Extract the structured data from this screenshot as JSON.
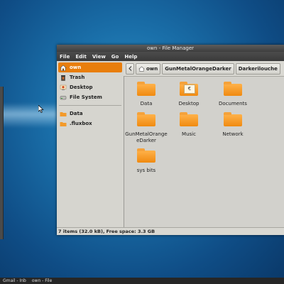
{
  "window": {
    "title": "own - File Manager"
  },
  "menu": [
    "File",
    "Edit",
    "View",
    "Go",
    "Help"
  ],
  "sidebar": {
    "items": [
      {
        "label": "own",
        "icon": "home-icon",
        "active": true
      },
      {
        "label": "Trash",
        "icon": "trash-icon"
      },
      {
        "label": "Desktop",
        "icon": "desktop-icon"
      },
      {
        "label": "File System",
        "icon": "drive-icon"
      }
    ],
    "bookmarks": [
      {
        "label": "Data",
        "icon": "folder-icon"
      },
      {
        "label": ".fluxbox",
        "icon": "folder-icon"
      }
    ]
  },
  "path": [
    "own",
    "GunMetalOrangeDarker",
    "Darkerilouche"
  ],
  "files": [
    {
      "label": "Data"
    },
    {
      "label": "Desktop"
    },
    {
      "label": "Documents"
    },
    {
      "label": "GunMetalOrange\neDarker"
    },
    {
      "label": "Music"
    },
    {
      "label": "Network"
    },
    {
      "label": "sys bits"
    }
  ],
  "status": "7 items (32.0 kB), Free space: 3.3 GB",
  "taskbar": [
    "Gmail - Inb",
    "own - File"
  ],
  "colors": {
    "accent": "#e87e0c",
    "folder": "#f08a10"
  }
}
